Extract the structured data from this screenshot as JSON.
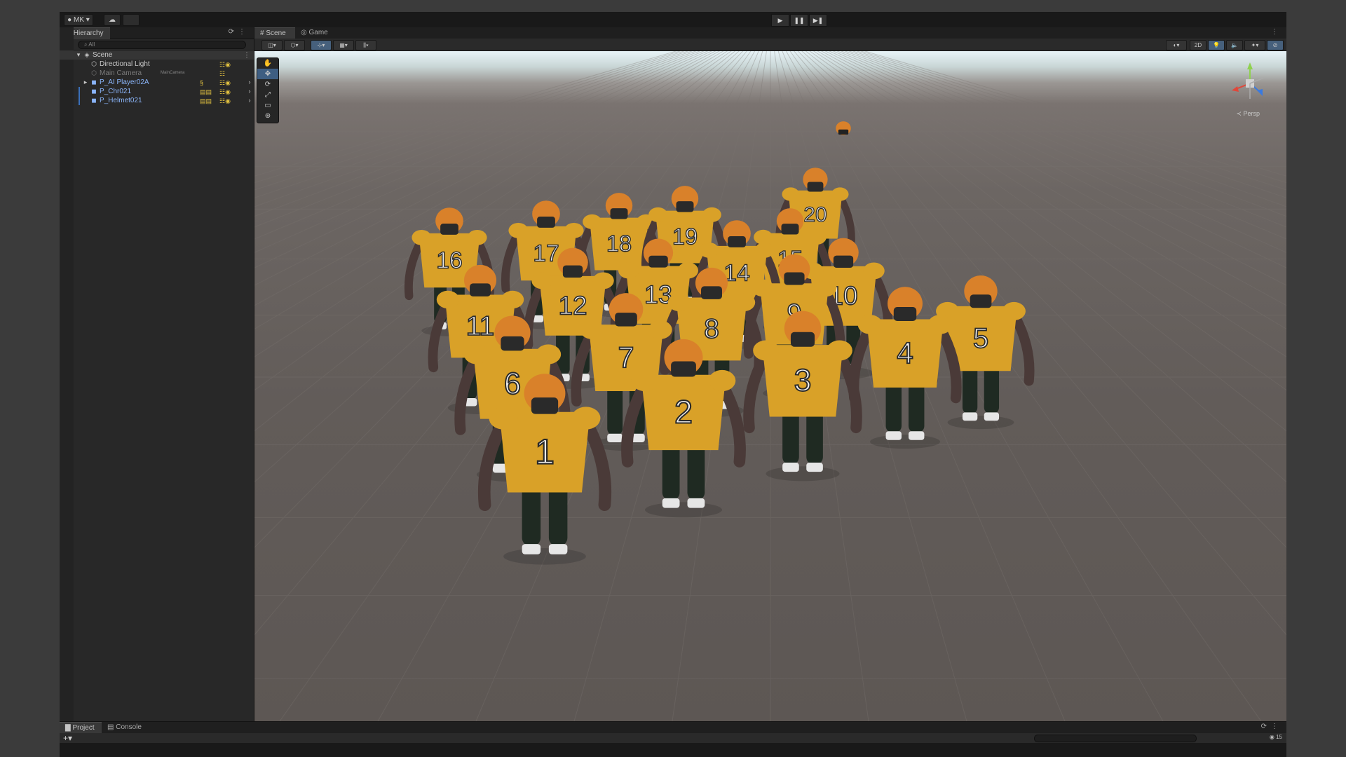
{
  "toolbar": {
    "account_label": "MK",
    "cloud_icon": "cloud-icon",
    "play_icon": "▶",
    "pause_icon": "❚❚",
    "step_icon": "▶❚"
  },
  "hierarchy": {
    "tab_label": "Hierarchy",
    "search_placeholder": "All",
    "items": [
      {
        "label": "Scene",
        "type": "scene"
      },
      {
        "label": "Directional Light",
        "type": "object"
      },
      {
        "label": "Main Camera",
        "type": "object",
        "tag": "MainCamera",
        "disabled": true
      },
      {
        "label": "P_AI Player02A",
        "type": "prefab"
      },
      {
        "label": "P_Chr021",
        "type": "prefab"
      },
      {
        "label": "P_Helmet021",
        "type": "prefab"
      }
    ]
  },
  "scene_view": {
    "tabs": [
      {
        "label": "Scene",
        "active": true
      },
      {
        "label": "Game",
        "active": false
      }
    ],
    "mode_2d_label": "2D",
    "persp_label": "Persp",
    "tools": [
      "hand-tool",
      "move-tool",
      "rotate-tool",
      "scale-tool",
      "rect-tool",
      "transform-tool"
    ],
    "players": [
      {
        "number": "20"
      },
      {
        "number": "16"
      },
      {
        "number": "17"
      },
      {
        "number": "18"
      },
      {
        "number": "19"
      },
      {
        "number": "15"
      },
      {
        "number": "14"
      },
      {
        "number": "13"
      },
      {
        "number": "12"
      },
      {
        "number": "11"
      },
      {
        "number": "10"
      },
      {
        "number": "9"
      },
      {
        "number": "8"
      },
      {
        "number": "7"
      },
      {
        "number": "6"
      },
      {
        "number": "5"
      },
      {
        "number": "4"
      },
      {
        "number": "3"
      },
      {
        "number": "2"
      },
      {
        "number": "1"
      },
      {
        "number": "1"
      }
    ],
    "colors": {
      "jersey": "#d9a128",
      "helmet": "#d9812a",
      "skin": "#4a3a38",
      "pants": "#1f2a22",
      "floor": "#625c59",
      "sky": "#e8f4f8"
    }
  },
  "bottom_panel": {
    "tabs": [
      {
        "label": "Project"
      },
      {
        "label": "Console"
      }
    ],
    "badge_count": "15"
  }
}
